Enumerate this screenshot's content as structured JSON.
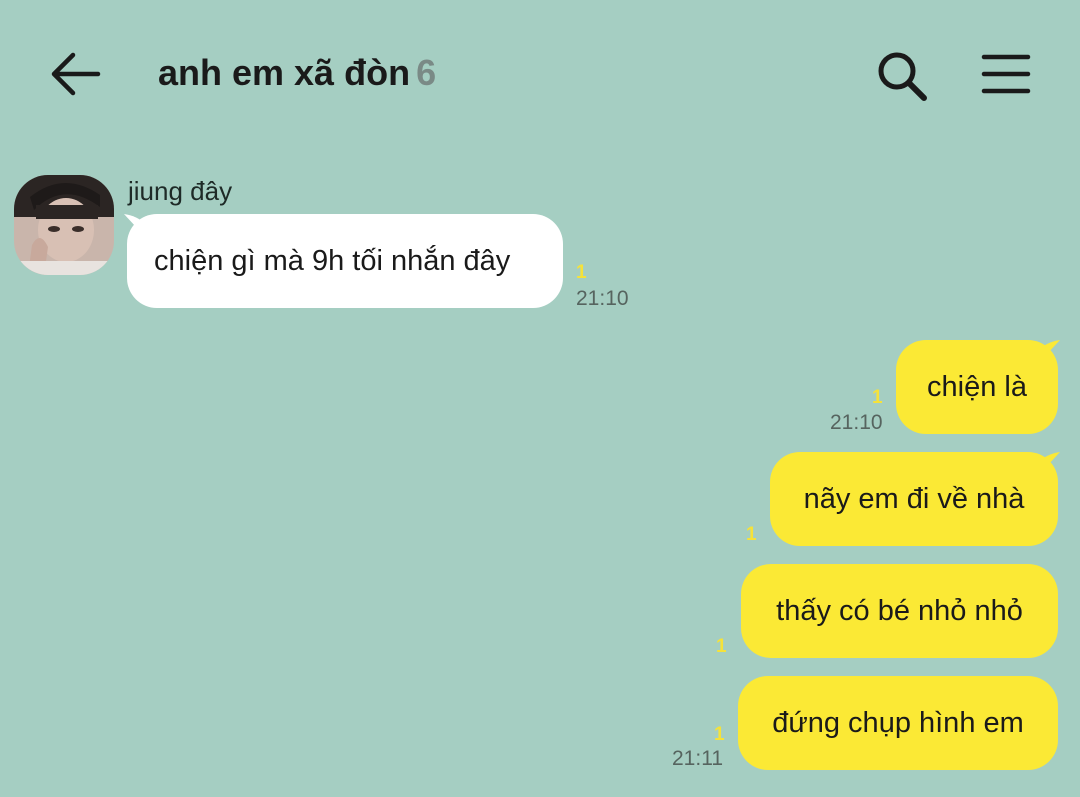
{
  "header": {
    "title": "anh em xã đòn",
    "member_count": "6",
    "back_icon": "arrow-left-icon",
    "search_icon": "search-icon",
    "menu_icon": "hamburger-menu-icon"
  },
  "colors": {
    "background": "#a5cec2",
    "incoming_bubble": "#ffffff",
    "outgoing_bubble": "#fbe935",
    "unread_count": "#f5e23a"
  },
  "messages": [
    {
      "direction": "incoming",
      "sender": "jiung đây",
      "text": "chiện gì mà 9h tối nhắn đây",
      "unread": "1",
      "time": "21:10"
    },
    {
      "direction": "outgoing",
      "text": "chiện là",
      "unread": "1",
      "time": "21:10"
    },
    {
      "direction": "outgoing",
      "text": "nãy em đi về nhà",
      "unread": "1",
      "time": ""
    },
    {
      "direction": "outgoing",
      "text": "thấy có bé nhỏ nhỏ",
      "unread": "1",
      "time": ""
    },
    {
      "direction": "outgoing",
      "text": "đứng chụp hình em",
      "unread": "1",
      "time": "21:11"
    }
  ]
}
